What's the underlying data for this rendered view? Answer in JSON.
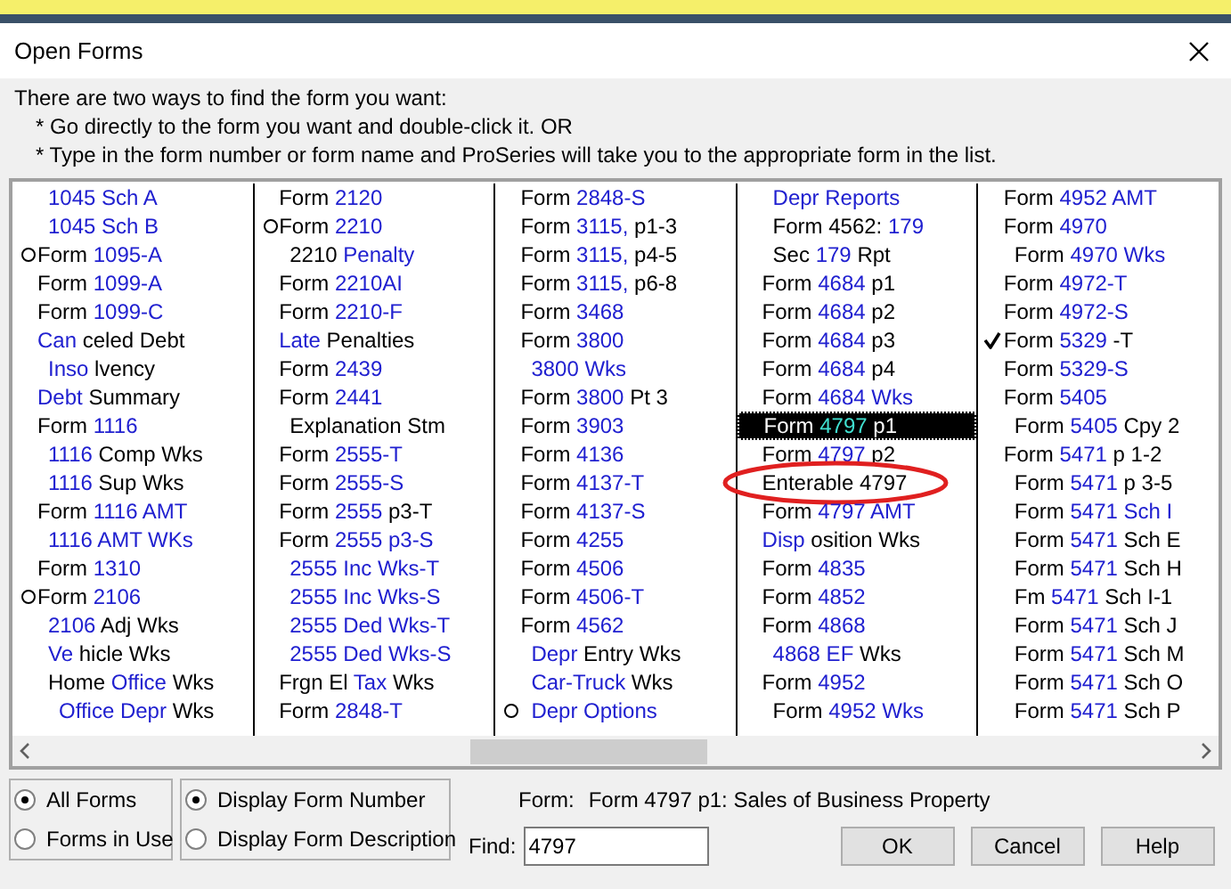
{
  "window": {
    "title": "Open Forms"
  },
  "instructions": [
    "There are two ways to find the form you want:",
    "* Go directly to the form you want and double-click it. OR",
    "* Type in the form number or form name and ProSeries will take you to the appropriate form in the list."
  ],
  "columns": [
    [
      {
        "kind": "sub",
        "link": "1045 Sch A"
      },
      {
        "kind": "sub",
        "link": "1045 Sch B"
      },
      {
        "kind": "main",
        "circle_mark": true,
        "plain": "Form",
        "link": "1095-A"
      },
      {
        "kind": "main",
        "plain": "Form",
        "link": "1099-A"
      },
      {
        "kind": "main",
        "plain": "Form",
        "link": "1099-C"
      },
      {
        "kind": "main",
        "link": "Can",
        "rest": "celed Debt"
      },
      {
        "kind": "sub",
        "link": "Inso",
        "rest": "lvency"
      },
      {
        "kind": "main",
        "link": "Debt",
        "rest": "Summary"
      },
      {
        "kind": "main",
        "plain": "Form",
        "link": "1116"
      },
      {
        "kind": "sub",
        "link": "1116",
        "rest": "Comp Wks"
      },
      {
        "kind": "sub",
        "link": "1116",
        "rest": "Sup Wks"
      },
      {
        "kind": "main",
        "plain": "Form",
        "link": "1116 AMT"
      },
      {
        "kind": "sub",
        "link": "1116 AMT WKs"
      },
      {
        "kind": "main",
        "plain": "Form",
        "link": "1310"
      },
      {
        "kind": "main",
        "circle_mark": true,
        "plain": "Form",
        "link": "2106"
      },
      {
        "kind": "sub",
        "link": "2106",
        "rest": "Adj Wks"
      },
      {
        "kind": "sub",
        "link": "Ve",
        "rest": "hicle Wks"
      },
      {
        "kind": "sub",
        "plain": "Home",
        "link": "Office",
        "rest": "Wks"
      },
      {
        "kind": "sub2",
        "link": "Office Depr",
        "rest": "Wks"
      }
    ],
    [
      {
        "kind": "main",
        "plain": "Form",
        "link": "2120"
      },
      {
        "kind": "main",
        "circle_mark": true,
        "plain": "Form",
        "link": "2210"
      },
      {
        "kind": "sub",
        "plain": "2210",
        "link": "Penalty"
      },
      {
        "kind": "main",
        "plain": "Form",
        "link": "2210AI"
      },
      {
        "kind": "main",
        "plain": "Form",
        "link": "2210-F"
      },
      {
        "kind": "main",
        "link": "Late",
        "rest": "Penalties"
      },
      {
        "kind": "main",
        "plain": "Form",
        "link": "2439"
      },
      {
        "kind": "main",
        "plain": "Form",
        "link": "2441"
      },
      {
        "kind": "sub",
        "plain": "Explanation Stm"
      },
      {
        "kind": "main",
        "plain": "Form",
        "link": "2555-T"
      },
      {
        "kind": "main",
        "plain": "Form",
        "link": "2555-S"
      },
      {
        "kind": "main",
        "plain": "Form",
        "link": "2555",
        "rest": "p3-T"
      },
      {
        "kind": "main",
        "plain": "Form",
        "link": "2555 p3-S"
      },
      {
        "kind": "sub",
        "link": "2555 Inc Wks-T"
      },
      {
        "kind": "sub",
        "link": "2555 Inc Wks-S"
      },
      {
        "kind": "sub",
        "link": "2555 Ded Wks-T"
      },
      {
        "kind": "sub",
        "link": "2555 Ded Wks-S"
      },
      {
        "kind": "main",
        "plain": "Frgn El",
        "link": "Tax",
        "rest": "Wks"
      },
      {
        "kind": "main",
        "plain": "Form",
        "link": "2848-T"
      }
    ],
    [
      {
        "kind": "main",
        "plain": "Form",
        "link": "2848-S"
      },
      {
        "kind": "main",
        "plain": "Form",
        "link": "3115,",
        "rest": "p1-3"
      },
      {
        "kind": "main",
        "plain": "Form",
        "link": "3115,",
        "rest": "p4-5"
      },
      {
        "kind": "main",
        "plain": "Form",
        "link": "3115,",
        "rest": "p6-8"
      },
      {
        "kind": "main",
        "plain": "Form",
        "link": "3468"
      },
      {
        "kind": "main",
        "plain": "Form",
        "link": "3800"
      },
      {
        "kind": "sub",
        "link": "3800 Wks"
      },
      {
        "kind": "main",
        "plain": "Form",
        "link": "3800",
        "rest": "Pt 3"
      },
      {
        "kind": "main",
        "plain": "Form",
        "link": "3903"
      },
      {
        "kind": "main",
        "plain": "Form",
        "link": "4136"
      },
      {
        "kind": "main",
        "plain": "Form",
        "link": "4137-T"
      },
      {
        "kind": "main",
        "plain": "Form",
        "link": "4137-S"
      },
      {
        "kind": "main",
        "plain": "Form",
        "link": "4255"
      },
      {
        "kind": "main",
        "plain": "Form",
        "link": "4506"
      },
      {
        "kind": "main",
        "plain": "Form",
        "link": "4506-T"
      },
      {
        "kind": "main",
        "plain": "Form",
        "link": "4562"
      },
      {
        "kind": "sub",
        "link": "Depr",
        "rest": "Entry Wks"
      },
      {
        "kind": "sub",
        "link": "Car-Truck",
        "rest": "Wks"
      },
      {
        "kind": "sub",
        "circle_mark": true,
        "link": "Depr Options"
      }
    ],
    [
      {
        "kind": "sub",
        "link": "Depr Reports"
      },
      {
        "kind": "sub",
        "plain": "Form 4562:",
        "link": "179"
      },
      {
        "kind": "sub",
        "plain": "Sec",
        "link": "179",
        "rest": "Rpt"
      },
      {
        "kind": "main",
        "plain": "Form",
        "link": "4684",
        "rest": "p1"
      },
      {
        "kind": "main",
        "plain": "Form",
        "link": "4684",
        "rest": "p2"
      },
      {
        "kind": "main",
        "plain": "Form",
        "link": "4684",
        "rest": "p3"
      },
      {
        "kind": "main",
        "plain": "Form",
        "link": "4684",
        "rest": "p4"
      },
      {
        "kind": "main",
        "plain": "Form",
        "link": "4684 Wks"
      },
      {
        "kind": "main",
        "selected": true,
        "plain": "Form",
        "link": "4797",
        "rest": "p1"
      },
      {
        "kind": "main",
        "plain": "Form",
        "link": "4797",
        "rest": "p2"
      },
      {
        "kind": "main",
        "circled": true,
        "plain": "Enterable 4797"
      },
      {
        "kind": "main",
        "plain": "Form",
        "link": "4797 AMT"
      },
      {
        "kind": "main",
        "link": "Disp",
        "rest": "osition Wks"
      },
      {
        "kind": "main",
        "plain": "Form",
        "link": "4835"
      },
      {
        "kind": "main",
        "plain": "Form",
        "link": "4852"
      },
      {
        "kind": "main",
        "plain": "Form",
        "link": "4868"
      },
      {
        "kind": "sub",
        "link": "4868 EF",
        "rest": "Wks"
      },
      {
        "kind": "main",
        "plain": "Form",
        "link": "4952"
      },
      {
        "kind": "sub",
        "plain": "Form",
        "link": "4952 Wks"
      }
    ],
    [
      {
        "kind": "main",
        "plain": "Form",
        "link": "4952 AMT"
      },
      {
        "kind": "main",
        "plain": "Form",
        "link": "4970"
      },
      {
        "kind": "sub",
        "plain": "Form",
        "link": "4970 Wks"
      },
      {
        "kind": "main",
        "plain": "Form",
        "link": "4972-T"
      },
      {
        "kind": "main",
        "plain": "Form",
        "link": "4972-S"
      },
      {
        "kind": "main",
        "check_mark": true,
        "plain": "Form",
        "link": "5329",
        "rest": "-T"
      },
      {
        "kind": "main",
        "plain": "Form",
        "link": "5329-S"
      },
      {
        "kind": "main",
        "plain": "Form",
        "link": "5405"
      },
      {
        "kind": "sub",
        "plain": "Form",
        "link": "5405",
        "rest": "Cpy 2"
      },
      {
        "kind": "main",
        "plain": "Form",
        "link": "5471",
        "rest": "p 1-2"
      },
      {
        "kind": "sub",
        "plain": "Form",
        "link": "5471",
        "rest": "p 3-5"
      },
      {
        "kind": "sub",
        "plain": "Form",
        "link": "5471 Sch I"
      },
      {
        "kind": "sub",
        "plain": "Form",
        "link": "5471",
        "rest": "Sch E"
      },
      {
        "kind": "sub",
        "plain": "Form",
        "link": "5471",
        "rest": "Sch H"
      },
      {
        "kind": "sub",
        "plain": "Fm",
        "link": "5471",
        "rest": "Sch I-1"
      },
      {
        "kind": "sub",
        "plain": "Form",
        "link": "5471",
        "rest": "Sch J"
      },
      {
        "kind": "sub",
        "plain": "Form",
        "link": "5471",
        "rest": "Sch M"
      },
      {
        "kind": "sub",
        "plain": "Form",
        "link": "5471",
        "rest": "Sch O"
      },
      {
        "kind": "sub",
        "plain": "Form",
        "link": "5471",
        "rest": "Sch P"
      }
    ]
  ],
  "scope": [
    {
      "label": "All Forms",
      "selected": true
    },
    {
      "label": "Forms in Use",
      "selected": false
    }
  ],
  "display": [
    {
      "label": "Display Form Number",
      "selected": true
    },
    {
      "label": "Display Form Description",
      "selected": false
    }
  ],
  "form_label": "Form:",
  "form_value": "Form 4797 p1: Sales of Business Property",
  "find_label": "Find:",
  "find_value": "4797",
  "buttons": [
    "OK",
    "Cancel",
    "Help"
  ]
}
